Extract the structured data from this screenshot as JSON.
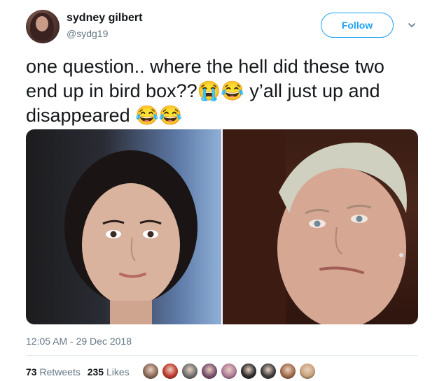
{
  "author": {
    "name": "sydney gilbert",
    "handle": "@sydg19",
    "avatar_icon": "user-avatar"
  },
  "follow_button": {
    "label": "Follow"
  },
  "menu_icon": "chevron-down-icon",
  "tweet": {
    "text": "one question.. where the hell did these two end up in bird box??😭😂 y’all just up and disappeared 😂😂"
  },
  "media": {
    "image_count": 2
  },
  "timestamp": "12:05 AM - 29 Dec 2018",
  "stats": {
    "retweets_count": "73",
    "retweets_label": "Retweets",
    "likes_count": "235",
    "likes_label": "Likes"
  },
  "likers": [
    {
      "color": "#8a6a55"
    },
    {
      "color": "#c0392b"
    },
    {
      "color": "#6f6f6f"
    },
    {
      "color": "#7a4f6e"
    },
    {
      "color": "#b07a9a"
    },
    {
      "color": "#2c2c2c"
    },
    {
      "color": "#3b3b3b"
    },
    {
      "color": "#a46a4a"
    },
    {
      "color": "#c9a37a"
    }
  ],
  "colors": {
    "accent": "#1da1f2",
    "text": "#14171a",
    "muted": "#657786"
  }
}
